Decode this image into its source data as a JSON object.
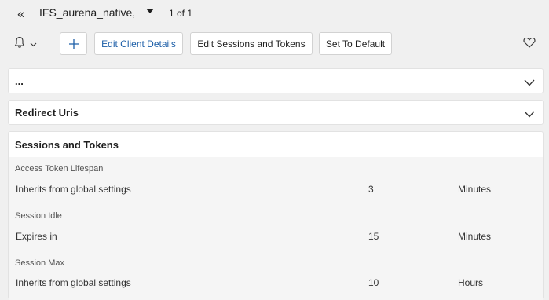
{
  "header": {
    "record_title": "IFS_aurena_native,",
    "pager": "1 of 1"
  },
  "toolbar": {
    "add_label": "+",
    "edit_client_label": "Edit Client Details",
    "edit_sessions_label": "Edit Sessions and Tokens",
    "set_default_label": "Set To Default"
  },
  "panels": {
    "general": {
      "title": "..."
    },
    "redirect": {
      "title": "Redirect Uris"
    },
    "sessions": {
      "title": "Sessions and Tokens",
      "fields": [
        {
          "label": "Access Token Lifespan",
          "description": "Inherits from global settings",
          "value": "3",
          "unit": "Minutes"
        },
        {
          "label": "Session Idle",
          "description": "Expires in",
          "value": "15",
          "unit": "Minutes"
        },
        {
          "label": "Session Max",
          "description": "Inherits from global settings",
          "value": "10",
          "unit": "Hours"
        }
      ]
    }
  },
  "colors": {
    "accent": "#1d5fa8",
    "page_background": "#f0f0f0",
    "section_background": "#f5f5f5"
  }
}
